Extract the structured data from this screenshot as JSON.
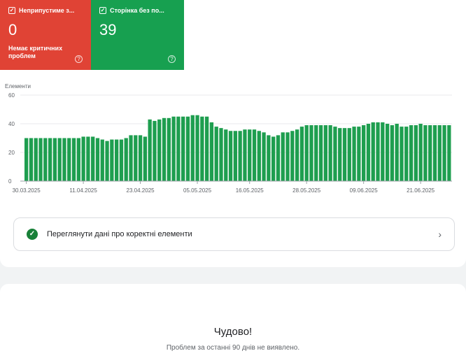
{
  "tiles": [
    {
      "title": "Неприпустиме з...",
      "value": "0",
      "subtitle": "Немає критичних проблем",
      "help_icon": "help-circle-icon",
      "color": "#e04335"
    },
    {
      "title": "Сторінка без по...",
      "value": "39",
      "help_icon": "help-circle-icon",
      "color": "#17a050"
    }
  ],
  "chart_data": {
    "type": "bar",
    "ylabel": "Елементи",
    "ylim": [
      0,
      60
    ],
    "yticks": [
      0,
      20,
      40,
      60
    ],
    "xtick_labels": [
      "30.03.2025",
      "11.04.2025",
      "23.04.2025",
      "05.05.2025",
      "16.05.2025",
      "28.05.2025",
      "09.06.2025",
      "21.06.2025"
    ],
    "xtick_indices": [
      0,
      12,
      24,
      36,
      47,
      59,
      71,
      83
    ],
    "bar_color": "#1e9e4f",
    "grid": true,
    "values": [
      30,
      30,
      30,
      30,
      30,
      30,
      30,
      30,
      30,
      30,
      30,
      30,
      31,
      31,
      31,
      30,
      29,
      28,
      29,
      29,
      29,
      30,
      32,
      32,
      32,
      31,
      43,
      42,
      43,
      44,
      44,
      45,
      45,
      45,
      45,
      46,
      46,
      45,
      45,
      41,
      38,
      37,
      36,
      35,
      35,
      35,
      36,
      36,
      36,
      35,
      34,
      32,
      31,
      32,
      34,
      34,
      35,
      36,
      38,
      39,
      39,
      39,
      39,
      39,
      39,
      38,
      37,
      37,
      37,
      38,
      38,
      39,
      40,
      41,
      41,
      41,
      40,
      39,
      40,
      38,
      38,
      39,
      39,
      40,
      39,
      39,
      39,
      39,
      39,
      39
    ]
  },
  "link": {
    "label": "Переглянути дані про коректні елементи",
    "icon": "check-circle-icon",
    "chevron": "chevron-right-icon"
  },
  "summary": {
    "title": "Чудово!",
    "subtitle": "Проблем за останні 90 днів не виявлено."
  }
}
